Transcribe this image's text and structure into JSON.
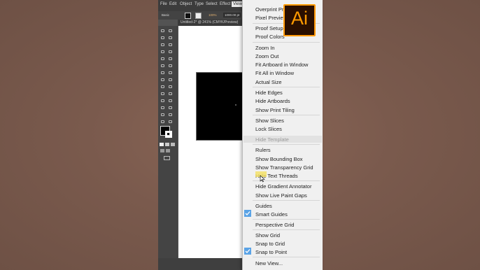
{
  "menubar": [
    "File",
    "Edit",
    "Object",
    "Type",
    "Select",
    "Effect",
    "View"
  ],
  "control": {
    "style_label": "Basic",
    "opacity": "100%",
    "width_value": "1000.00 pt"
  },
  "document_tab": "Untitled-2* @ 241% (CMYK/Preview)",
  "logo": {
    "text": "Ai",
    "accent": "#ff9a00",
    "bg": "#2a0f00"
  },
  "view_menu": {
    "items": [
      {
        "label": "Overprint Preview",
        "enabled": true
      },
      {
        "label": "Pixel Preview",
        "enabled": true
      },
      {
        "label": "Proof Setup",
        "enabled": true
      },
      {
        "label": "Proof Colors",
        "enabled": true
      },
      {
        "label": "Zoom In",
        "enabled": true
      },
      {
        "label": "Zoom Out",
        "enabled": true
      },
      {
        "label": "Fit Artboard in Window",
        "enabled": true
      },
      {
        "label": "Fit All in Window",
        "enabled": true
      },
      {
        "label": "Actual Size",
        "enabled": true
      },
      {
        "label": "Hide Edges",
        "enabled": true
      },
      {
        "label": "Hide Artboards",
        "enabled": true
      },
      {
        "label": "Show Print Tiling",
        "enabled": true
      },
      {
        "label": "Show Slices",
        "enabled": true
      },
      {
        "label": "Lock Slices",
        "enabled": true
      },
      {
        "label": "Hide Template",
        "enabled": false
      },
      {
        "label": "Rulers",
        "enabled": true
      },
      {
        "label": "Show Bounding Box",
        "enabled": true
      },
      {
        "label": "Show Transparency Grid",
        "enabled": true
      },
      {
        "label": "Hide Text Threads",
        "enabled": true
      },
      {
        "label": "Hide Gradient Annotator",
        "enabled": true
      },
      {
        "label": "Show Live Paint Gaps",
        "enabled": true
      },
      {
        "label": "Guides",
        "enabled": true
      },
      {
        "label": "Smart Guides",
        "enabled": true,
        "checked": true
      },
      {
        "label": "Perspective Grid",
        "enabled": true
      },
      {
        "label": "Show Grid",
        "enabled": true
      },
      {
        "label": "Snap to Grid",
        "enabled": true
      },
      {
        "label": "Snap to Point",
        "enabled": true,
        "checked": true
      },
      {
        "label": "New View...",
        "enabled": true
      }
    ]
  }
}
